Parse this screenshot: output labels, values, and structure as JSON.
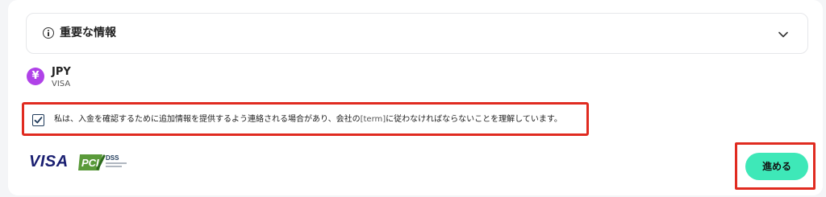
{
  "accordion": {
    "title": "重要な情報",
    "info_icon": "info-circle-icon",
    "chevron_icon": "chevron-down-icon"
  },
  "currency": {
    "symbol": "¥",
    "code": "JPY",
    "network": "VISA",
    "icon_color": "#b042e8"
  },
  "consent": {
    "checked": true,
    "text_before": "私は、入金を確認するために追加情報を提供するよう連絡される場合があり、会社の",
    "link_text": "[term]",
    "text_after": "に従わなければならないことを理解しています。"
  },
  "logos": {
    "visa": "VISA",
    "pci": "PCI DSS"
  },
  "actions": {
    "proceed_label": "進める",
    "proceed_color": "#3ee8b8"
  },
  "highlight_color": "#e02b20"
}
